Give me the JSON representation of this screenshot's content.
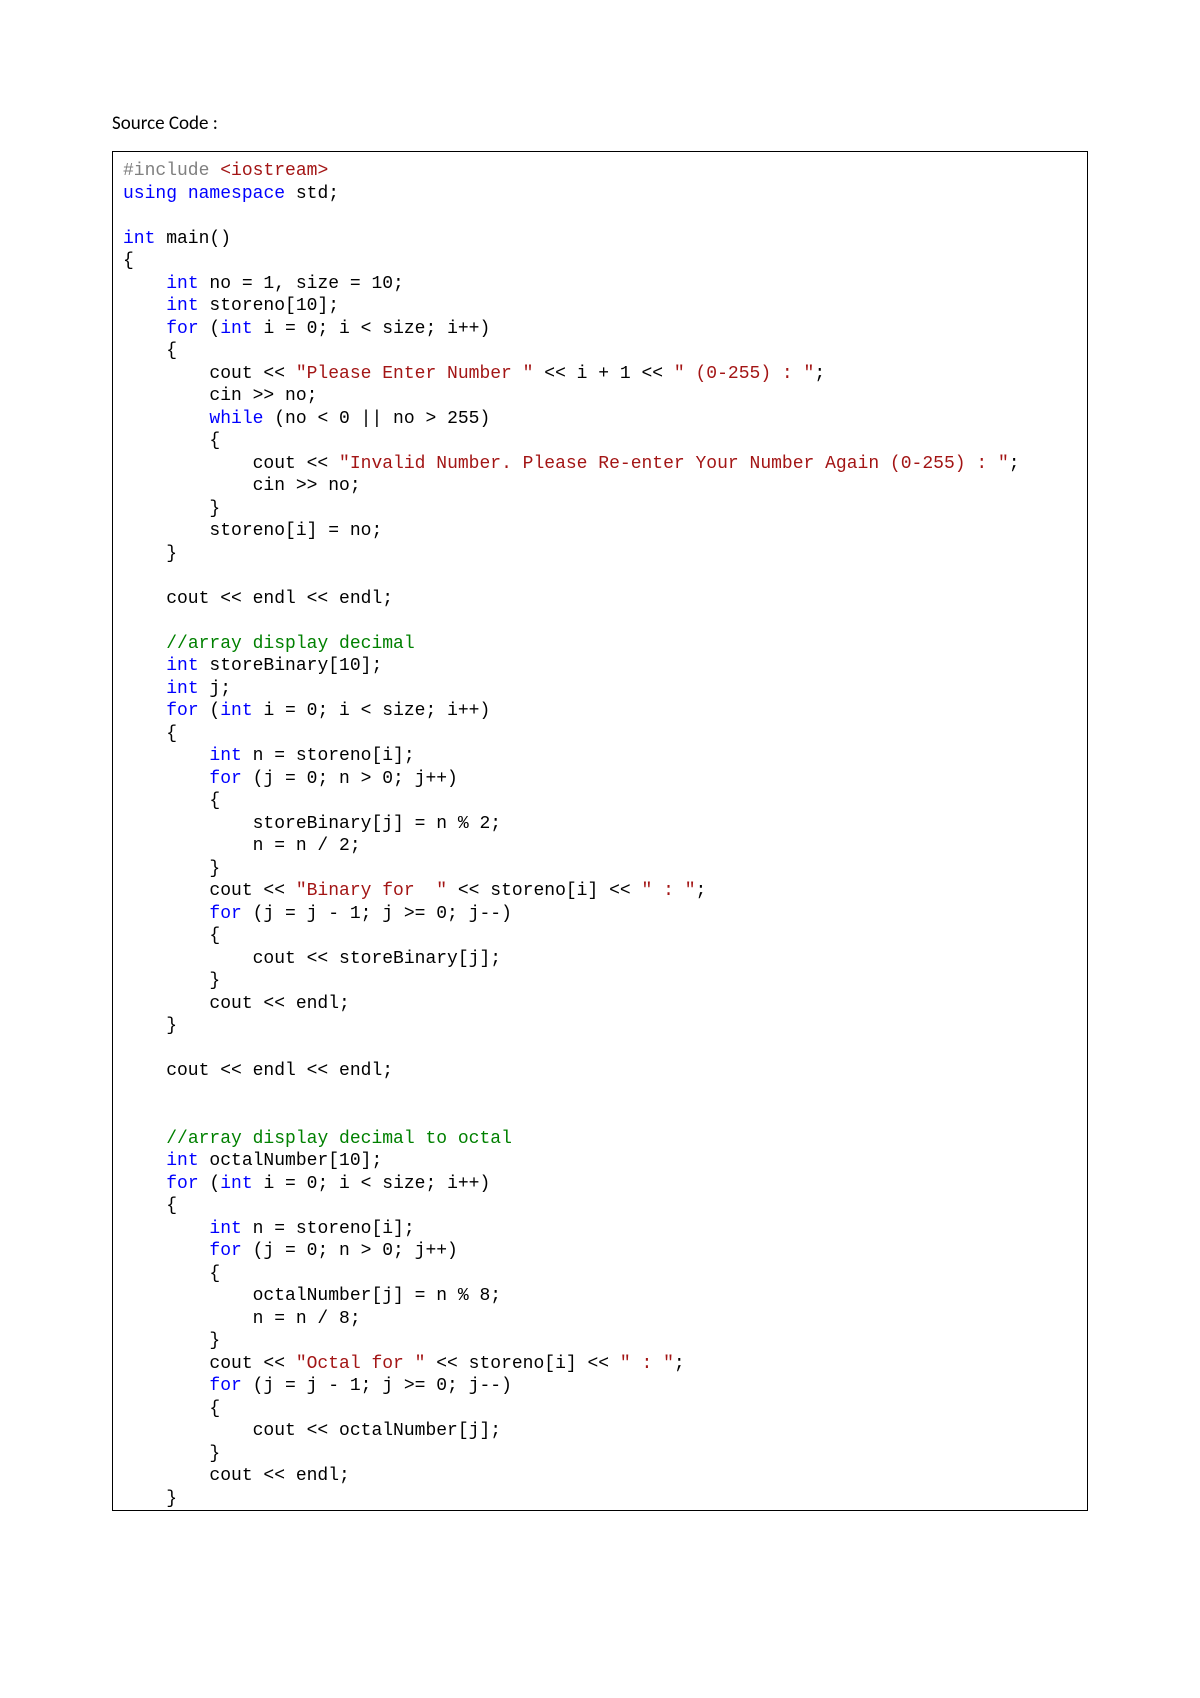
{
  "heading": "Source Code :",
  "code": {
    "tokens": [
      {
        "text": "#include",
        "cls": "t-preproc"
      },
      {
        "text": " "
      },
      {
        "text": "<iostream>",
        "cls": "t-string-angle"
      },
      {
        "text": "\n"
      },
      {
        "text": "using",
        "cls": "t-keyword"
      },
      {
        "text": " "
      },
      {
        "text": "namespace",
        "cls": "t-keyword"
      },
      {
        "text": " std;\n"
      },
      {
        "text": "\n"
      },
      {
        "text": "int",
        "cls": "t-keyword"
      },
      {
        "text": " main()\n"
      },
      {
        "text": "{\n"
      },
      {
        "text": "    "
      },
      {
        "text": "int",
        "cls": "t-keyword"
      },
      {
        "text": " no = 1, size = 10;\n"
      },
      {
        "text": "    "
      },
      {
        "text": "int",
        "cls": "t-keyword"
      },
      {
        "text": " storeno[10];\n"
      },
      {
        "text": "    "
      },
      {
        "text": "for",
        "cls": "t-keyword"
      },
      {
        "text": " ("
      },
      {
        "text": "int",
        "cls": "t-keyword"
      },
      {
        "text": " i = 0; i < size; i++)\n"
      },
      {
        "text": "    {\n"
      },
      {
        "text": "        cout << "
      },
      {
        "text": "\"Please Enter Number \"",
        "cls": "t-string"
      },
      {
        "text": " << i + 1 << "
      },
      {
        "text": "\" (0-255) : \"",
        "cls": "t-string"
      },
      {
        "text": ";\n"
      },
      {
        "text": "        cin >> no;\n"
      },
      {
        "text": "        "
      },
      {
        "text": "while",
        "cls": "t-keyword"
      },
      {
        "text": " (no < 0 || no > 255)\n"
      },
      {
        "text": "        {\n"
      },
      {
        "text": "            cout << "
      },
      {
        "text": "\"Invalid Number. Please Re-enter Your Number Again (0-255) : \"",
        "cls": "t-string"
      },
      {
        "text": ";\n"
      },
      {
        "text": "            cin >> no;\n"
      },
      {
        "text": "        }\n"
      },
      {
        "text": "        storeno[i] = no;\n"
      },
      {
        "text": "    }\n"
      },
      {
        "text": "\n"
      },
      {
        "text": "    cout << endl << endl;\n"
      },
      {
        "text": "\n"
      },
      {
        "text": "    "
      },
      {
        "text": "//array display decimal",
        "cls": "t-comment"
      },
      {
        "text": "\n"
      },
      {
        "text": "    "
      },
      {
        "text": "int",
        "cls": "t-keyword"
      },
      {
        "text": " storeBinary[10];\n"
      },
      {
        "text": "    "
      },
      {
        "text": "int",
        "cls": "t-keyword"
      },
      {
        "text": " j;\n"
      },
      {
        "text": "    "
      },
      {
        "text": "for",
        "cls": "t-keyword"
      },
      {
        "text": " ("
      },
      {
        "text": "int",
        "cls": "t-keyword"
      },
      {
        "text": " i = 0; i < size; i++)\n"
      },
      {
        "text": "    {\n"
      },
      {
        "text": "        "
      },
      {
        "text": "int",
        "cls": "t-keyword"
      },
      {
        "text": " n = storeno[i];\n"
      },
      {
        "text": "        "
      },
      {
        "text": "for",
        "cls": "t-keyword"
      },
      {
        "text": " (j = 0; n > 0; j++)\n"
      },
      {
        "text": "        {\n"
      },
      {
        "text": "            storeBinary[j] = n % 2;\n"
      },
      {
        "text": "            n = n / 2;\n"
      },
      {
        "text": "        }\n"
      },
      {
        "text": "        cout << "
      },
      {
        "text": "\"Binary for  \"",
        "cls": "t-string"
      },
      {
        "text": " << storeno[i] << "
      },
      {
        "text": "\" : \"",
        "cls": "t-string"
      },
      {
        "text": ";\n"
      },
      {
        "text": "        "
      },
      {
        "text": "for",
        "cls": "t-keyword"
      },
      {
        "text": " (j = j - 1; j >= 0; j--)\n"
      },
      {
        "text": "        {\n"
      },
      {
        "text": "            cout << storeBinary[j];\n"
      },
      {
        "text": "        }\n"
      },
      {
        "text": "        cout << endl;\n"
      },
      {
        "text": "    }\n"
      },
      {
        "text": "\n"
      },
      {
        "text": "    cout << endl << endl;\n"
      },
      {
        "text": "\n"
      },
      {
        "text": "\n"
      },
      {
        "text": "    "
      },
      {
        "text": "//array display decimal to octal",
        "cls": "t-comment"
      },
      {
        "text": "\n"
      },
      {
        "text": "    "
      },
      {
        "text": "int",
        "cls": "t-keyword"
      },
      {
        "text": " octalNumber[10];\n"
      },
      {
        "text": "    "
      },
      {
        "text": "for",
        "cls": "t-keyword"
      },
      {
        "text": " ("
      },
      {
        "text": "int",
        "cls": "t-keyword"
      },
      {
        "text": " i = 0; i < size; i++)\n"
      },
      {
        "text": "    {\n"
      },
      {
        "text": "        "
      },
      {
        "text": "int",
        "cls": "t-keyword"
      },
      {
        "text": " n = storeno[i];\n"
      },
      {
        "text": "        "
      },
      {
        "text": "for",
        "cls": "t-keyword"
      },
      {
        "text": " (j = 0; n > 0; j++)\n"
      },
      {
        "text": "        {\n"
      },
      {
        "text": "            octalNumber[j] = n % 8;\n"
      },
      {
        "text": "            n = n / 8;\n"
      },
      {
        "text": "        }\n"
      },
      {
        "text": "        cout << "
      },
      {
        "text": "\"Octal for \"",
        "cls": "t-string"
      },
      {
        "text": " << storeno[i] << "
      },
      {
        "text": "\" : \"",
        "cls": "t-string"
      },
      {
        "text": ";\n"
      },
      {
        "text": "        "
      },
      {
        "text": "for",
        "cls": "t-keyword"
      },
      {
        "text": " (j = j - 1; j >= 0; j--)\n"
      },
      {
        "text": "        {\n"
      },
      {
        "text": "            cout << octalNumber[j];\n"
      },
      {
        "text": "        }\n"
      },
      {
        "text": "        cout << endl;\n"
      },
      {
        "text": "    }"
      }
    ]
  }
}
